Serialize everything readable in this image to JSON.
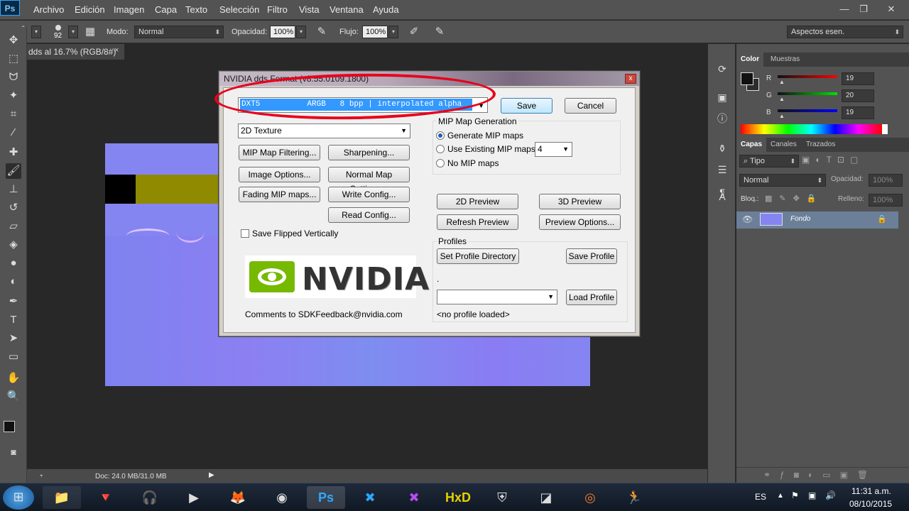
{
  "app": {
    "logo": "Ps"
  },
  "menu": [
    "Archivo",
    "Edición",
    "Imagen",
    "Capa",
    "Texto",
    "Selección",
    "Filtro",
    "Vista",
    "Ventana",
    "Ayuda"
  ],
  "window_controls": {
    "minimize": "—",
    "restore": "❐",
    "close": "✕"
  },
  "options_bar": {
    "brush_size": "92",
    "mode_label": "Modo:",
    "mode_value": "Normal",
    "opacity_label": "Opacidad:",
    "opacity_value": "100%",
    "flow_label": "Flujo:",
    "flow_value": "100%",
    "workspace": "Aspectos esen."
  },
  "document": {
    "tab_title": "dds al 16.7% (RGB/8#)",
    "tab_close": "×",
    "doc_size": "Doc: 24.0 MB/31.0 MB"
  },
  "color_panel": {
    "tabs": [
      "Color",
      "Muestras"
    ],
    "r_label": "R",
    "r_value": "19",
    "g_label": "G",
    "g_value": "20",
    "b_label": "B",
    "b_value": "19"
  },
  "layers_panel": {
    "tabs": [
      "Capas",
      "Canales",
      "Trazados"
    ],
    "filter": "Tipo",
    "blend_mode": "Normal",
    "opacity_label": "Opacidad:",
    "opacity_value": "100%",
    "lock_label": "Bloq.:",
    "fill_label": "Relleno:",
    "fill_value": "100%",
    "layer_name": "Fondo"
  },
  "dialog": {
    "title": "NVIDIA dds Format (v8.55.0109.1800)",
    "close": "x",
    "format_value": "DXT5          ARGB   8 bpp | interpolated alpha",
    "save": "Save",
    "cancel": "Cancel",
    "texture_type": "2D Texture",
    "btn_mip_filtering": "MIP Map Filtering...",
    "btn_sharpening": "Sharpening...",
    "btn_image_options": "Image Options...",
    "btn_normal_map": "Normal Map Settings...",
    "btn_fading": "Fading MIP maps...",
    "btn_write_config": "Write Config...",
    "btn_read_config": "Read Config...",
    "save_flipped": "Save Flipped Vertically",
    "mip_group": "MIP Map Generation",
    "mip_generate": "Generate MIP maps",
    "mip_existing": "Use Existing MIP maps",
    "mip_existing_count": "4",
    "mip_none": "No MIP maps",
    "btn_2d_preview": "2D Preview",
    "btn_3d_preview": "3D Preview",
    "btn_refresh": "Refresh Preview",
    "btn_preview_options": "Preview Options...",
    "profiles_label": "Profiles",
    "btn_set_profile_dir": "Set Profile Directory",
    "btn_save_profile": "Save Profile",
    "profile_path": ".",
    "btn_load_profile": "Load Profile",
    "no_profile": "<no profile loaded>",
    "logo_text": "NVIDIA",
    "comments": "Comments to SDKFeedback@nvidia.com"
  },
  "taskbar": {
    "lang": "ES",
    "time": "11:31 a.m.",
    "date": "08/10/2015"
  },
  "colors": {
    "annotation": "#e8001c",
    "normal_map": "#8585f2",
    "selection": "#3399ff"
  }
}
